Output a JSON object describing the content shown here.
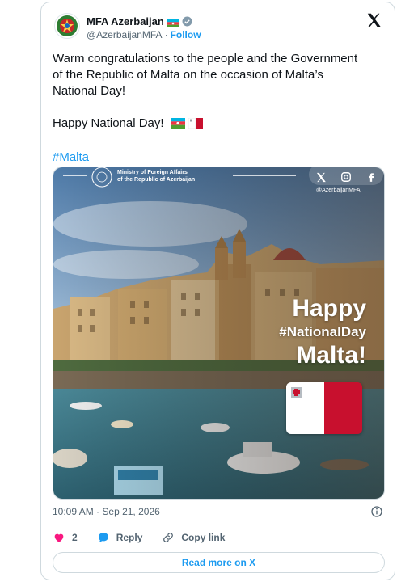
{
  "author": {
    "display_name": "MFA Azerbaijan",
    "handle": "@AzerbaijanMFA",
    "separator": "·",
    "follow_label": "Follow"
  },
  "tweet": {
    "lines": [
      "Warm congratulations to the people and the Government",
      "of the Republic of Malta on the occasion of Malta’s",
      "National Day!"
    ],
    "greeting": "Happy National Day!",
    "hashtag": "#Malta"
  },
  "media": {
    "ministry_line1": "Ministry of Foreign Affairs",
    "ministry_line2": "of the Republic of Azerbaijan",
    "social_handle": "@AzerbaijanMFA",
    "headline_1": "Happy",
    "headline_2": "#NationalDay",
    "headline_3": "Malta!"
  },
  "meta": {
    "time": "10:09 AM",
    "sep": "·",
    "date": "Sep 21, 2026"
  },
  "actions": {
    "like_count": "2",
    "reply_label": "Reply",
    "copy_label": "Copy link"
  },
  "read_more": "Read more on X",
  "icons": [
    "azerbaijan-emblem-icon",
    "azerbaijan-flag-icon",
    "verified-badge-icon",
    "x-logo-icon",
    "malta-flag-icon",
    "info-icon",
    "heart-icon",
    "reply-icon",
    "link-icon"
  ],
  "colors": {
    "accent": "#1d9bf0",
    "like": "#f91880",
    "malta_red": "#c8102e"
  }
}
